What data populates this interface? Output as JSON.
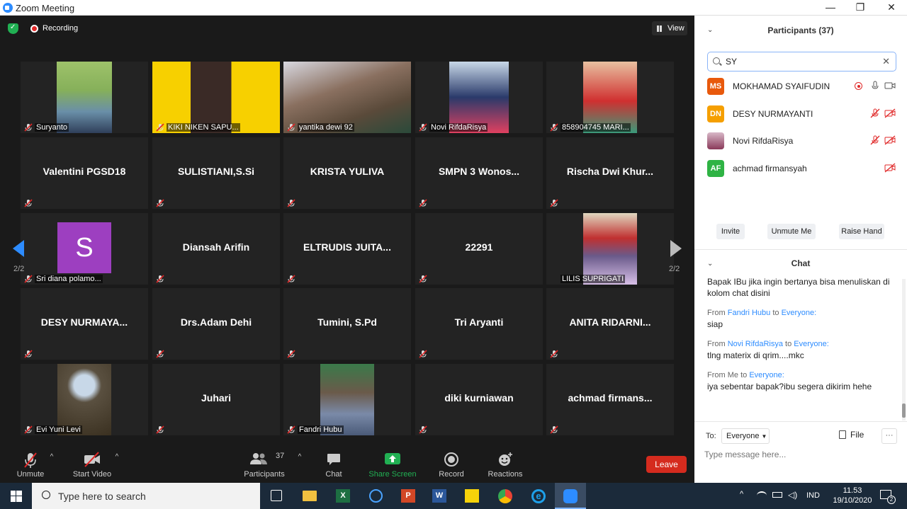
{
  "window": {
    "title": "Zoom Meeting",
    "minimize": "—",
    "restore": "❐",
    "close": "✕"
  },
  "topbar": {
    "recording_label": "Recording",
    "view_label": "View"
  },
  "tiles": [
    {
      "name": "Suryanto",
      "type": "video"
    },
    {
      "name": "KIKI NIKEN SAPU...",
      "type": "video"
    },
    {
      "name": "yantika dewi 92",
      "type": "video"
    },
    {
      "name": "Novi RifdaRisya",
      "type": "video"
    },
    {
      "name": "858904745 MARI...",
      "type": "video"
    },
    {
      "name": "Valentini PGSD18",
      "type": "text"
    },
    {
      "name": "SULISTIANI,S.Si",
      "type": "text"
    },
    {
      "name": "KRISTA YULIVA",
      "type": "text"
    },
    {
      "name": "SMPN 3 Wonos...",
      "type": "text"
    },
    {
      "name": "Rischa Dwi Khur...",
      "type": "text"
    },
    {
      "name": "Sri diana polamo...",
      "type": "avatar",
      "letter": "S"
    },
    {
      "name": "Diansah Arifin",
      "type": "text"
    },
    {
      "name": "ELTRUDIS JUITA...",
      "type": "text"
    },
    {
      "name": "22291",
      "type": "text"
    },
    {
      "name": "LILIS SUPRIGATI",
      "type": "video"
    },
    {
      "name": "DESY NURMAYA...",
      "type": "text"
    },
    {
      "name": "Drs.Adam Dehi",
      "type": "text"
    },
    {
      "name": "Tumini, S.Pd",
      "type": "text"
    },
    {
      "name": "Tri Aryanti",
      "type": "text"
    },
    {
      "name": "ANITA RIDARNI...",
      "type": "text"
    },
    {
      "name": "Evi Yuni Levi",
      "type": "video"
    },
    {
      "name": "Juhari",
      "type": "text"
    },
    {
      "name": "Fandri Hubu",
      "type": "video"
    },
    {
      "name": "diki kurniawan",
      "type": "text"
    },
    {
      "name": "achmad firmans...",
      "type": "text"
    }
  ],
  "pager": {
    "left": "2/2",
    "right": "2/2"
  },
  "toolbar": {
    "unmute": "Unmute",
    "start_video": "Start Video",
    "participants": "Participants",
    "participants_count": "37",
    "chat": "Chat",
    "share_screen": "Share Screen",
    "record": "Record",
    "reactions": "Reactions",
    "leave": "Leave"
  },
  "participants_panel": {
    "title": "Participants (37)",
    "search_value": "SY",
    "rows": [
      {
        "initials": "MS",
        "name": "MOKHAMAD SYAIFUDIN",
        "color": "#e8590c"
      },
      {
        "initials": "DN",
        "name": "DESY NURMAYANTI",
        "color": "#f59f00"
      },
      {
        "initials": "",
        "name": "Novi RifdaRisya",
        "color": "#b04a6a"
      },
      {
        "initials": "AF",
        "name": "achmad firmansyah",
        "color": "#2fb344"
      }
    ],
    "invite": "Invite",
    "unmute_me": "Unmute Me",
    "raise_hand": "Raise Hand"
  },
  "chat_panel": {
    "title": "Chat",
    "first_text": "Bapak IBu jika ingin bertanya bisa menuliskan di kolom chat disini",
    "messages": [
      {
        "from_label": "From",
        "sender": "Fandri Hubu",
        "to_label": "to",
        "to": "Everyone:",
        "text": "siap"
      },
      {
        "from_label": "From",
        "sender": "Novi RifdaRisya",
        "to_label": "to",
        "to": "Everyone:",
        "text": "tlng materix di qrim....mkc"
      },
      {
        "from_label": "From Me",
        "sender": "",
        "to_label": "to",
        "to": "Everyone:",
        "text": "iya sebentar bapak?ibu segera dikirim hehe"
      }
    ],
    "to_label": "To:",
    "to_value": "Everyone",
    "file": "File",
    "more": "···",
    "placeholder": "Type message here..."
  },
  "taskbar": {
    "search_placeholder": "Type here to search",
    "lang": "IND",
    "time": "11.53",
    "date": "19/10/2020",
    "notif_count": "2"
  }
}
